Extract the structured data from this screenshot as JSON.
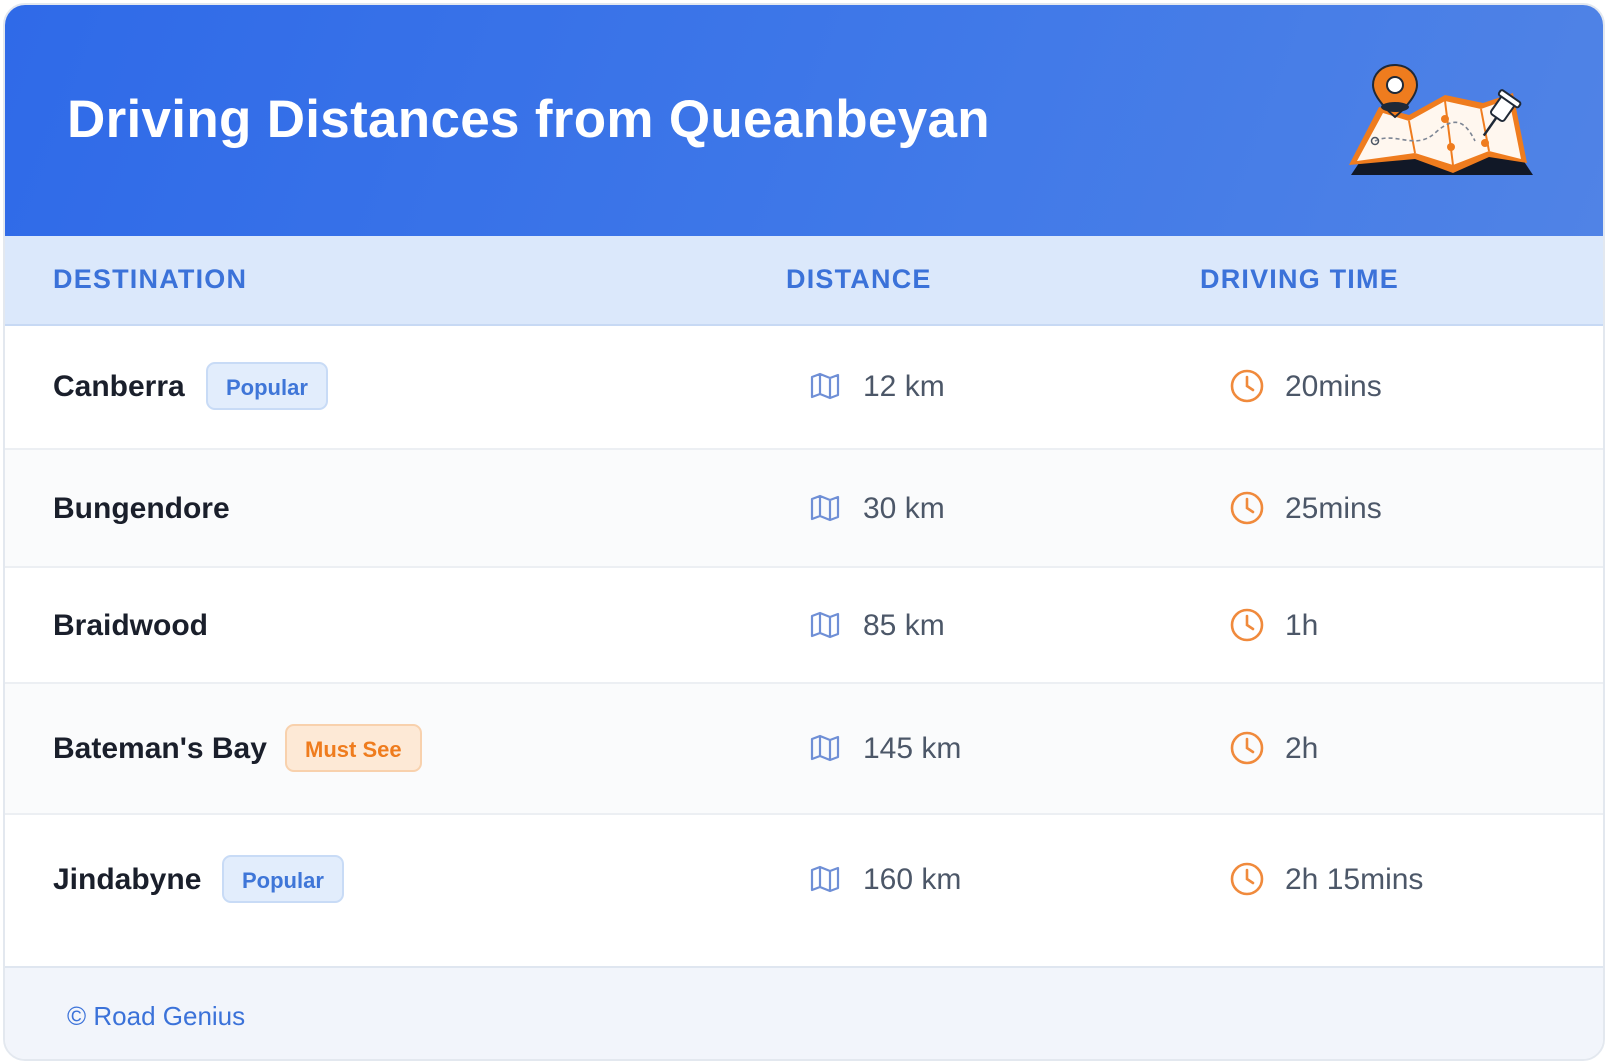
{
  "header": {
    "title": "Driving Distances from Queanbeyan"
  },
  "columns": {
    "destination": "DESTINATION",
    "distance": "DISTANCE",
    "driving_time": "DRIVING TIME"
  },
  "rows": [
    {
      "destination": "Canberra",
      "badge": "Popular",
      "distance": "12 km",
      "time": "20mins"
    },
    {
      "destination": "Bungendore",
      "badge": "",
      "distance": "30 km",
      "time": "25mins"
    },
    {
      "destination": "Braidwood",
      "badge": "",
      "distance": "85 km",
      "time": "1h"
    },
    {
      "destination": "Bateman's Bay",
      "badge": "Must See",
      "distance": "145 km",
      "time": "2h"
    },
    {
      "destination": "Jindabyne",
      "badge": "Popular",
      "distance": "160 km",
      "time": "2h 15mins"
    }
  ],
  "footer": {
    "text": "© Road Genius"
  },
  "icons": {
    "distance": "map-icon",
    "time": "clock-icon",
    "header": "map-pin-illustration"
  },
  "colors": {
    "header_bg": "#2f6ae8",
    "accent_blue": "#3b72d9",
    "accent_orange": "#ef7c1e"
  }
}
